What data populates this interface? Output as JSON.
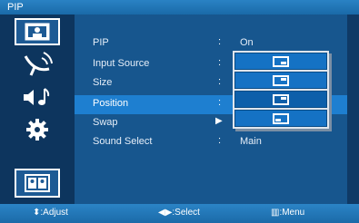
{
  "title": "PIP",
  "sidebar": {
    "icons": [
      "picture-icon",
      "antenna-icon",
      "audio-icon",
      "gear-icon",
      "pip-icon"
    ]
  },
  "menu": {
    "rows": [
      {
        "label": "PIP",
        "value": "On"
      },
      {
        "label": "Input Source",
        "value": ""
      },
      {
        "label": "Size",
        "value": ""
      },
      {
        "label": "Position",
        "value": ""
      },
      {
        "label": "Swap",
        "value": ""
      },
      {
        "label": "Sound Select",
        "value": "Main"
      }
    ],
    "selected_row": "Position"
  },
  "position_options": [
    "top-left",
    "top-right",
    "bottom-left",
    "bottom-right"
  ],
  "footer": {
    "adjust": ":Adjust",
    "select": ":Select",
    "menu": ":Menu"
  },
  "colors": {
    "background": "#0f3a66",
    "panel": "#17568e",
    "highlight": "#1e7fd0"
  }
}
